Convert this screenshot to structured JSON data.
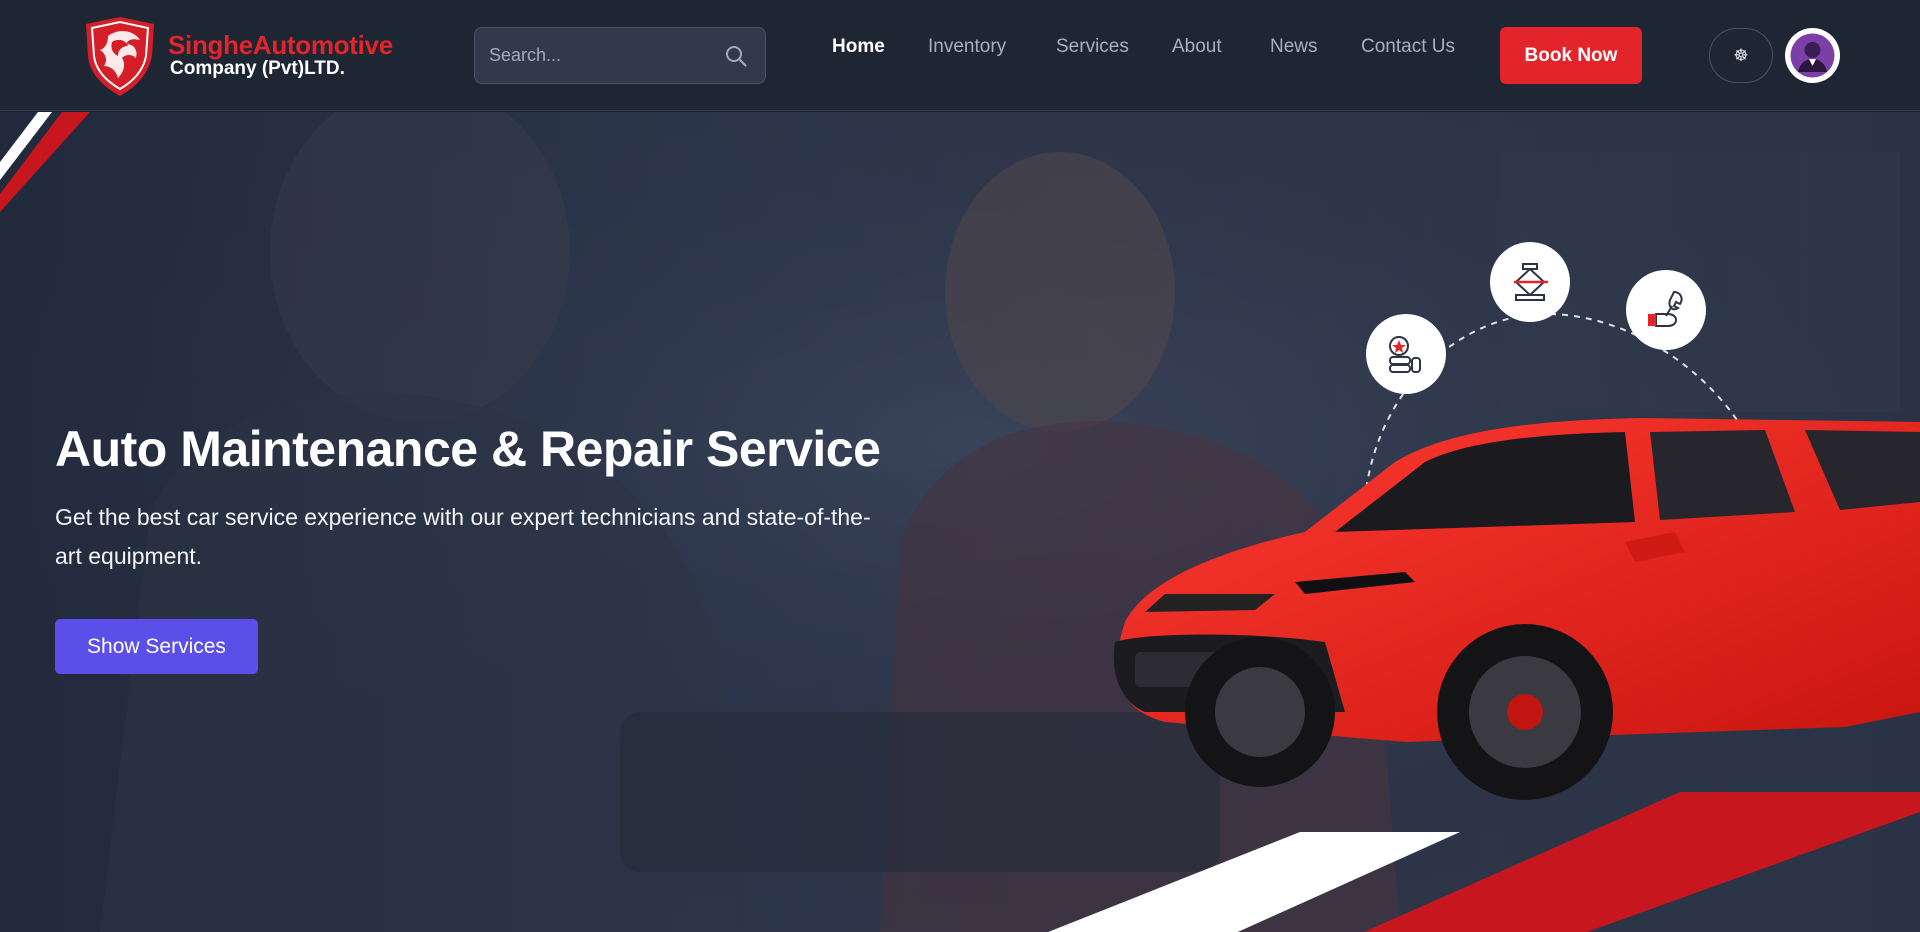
{
  "header": {
    "logo": {
      "name": "SingheAutomotive",
      "subtitle": "Company (Pvt)LTD."
    },
    "search": {
      "placeholder": "Search..."
    },
    "nav": [
      {
        "label": "Home",
        "active": true
      },
      {
        "label": "Inventory",
        "active": false
      },
      {
        "label": "Services",
        "active": false
      },
      {
        "label": "About",
        "active": false
      },
      {
        "label": "News",
        "active": false
      },
      {
        "label": "Contact Us",
        "active": false
      }
    ],
    "book_label": "Book Now",
    "theme_toggle_icon": "sun-gear-icon",
    "avatar_icon": "user-avatar-icon"
  },
  "hero": {
    "title": "Auto Maintenance & Repair Service",
    "subtitle": "Get the best car service experience with our expert technicians and state-of-the-art equipment.",
    "cta_label": "Show Services",
    "service_icons": [
      "tire-icon",
      "car-jack-icon",
      "wrench-hand-icon"
    ]
  },
  "colors": {
    "brand_red": "#e3242b",
    "cta_purple": "#5b4fe9",
    "header_bg": "#1e2533"
  }
}
